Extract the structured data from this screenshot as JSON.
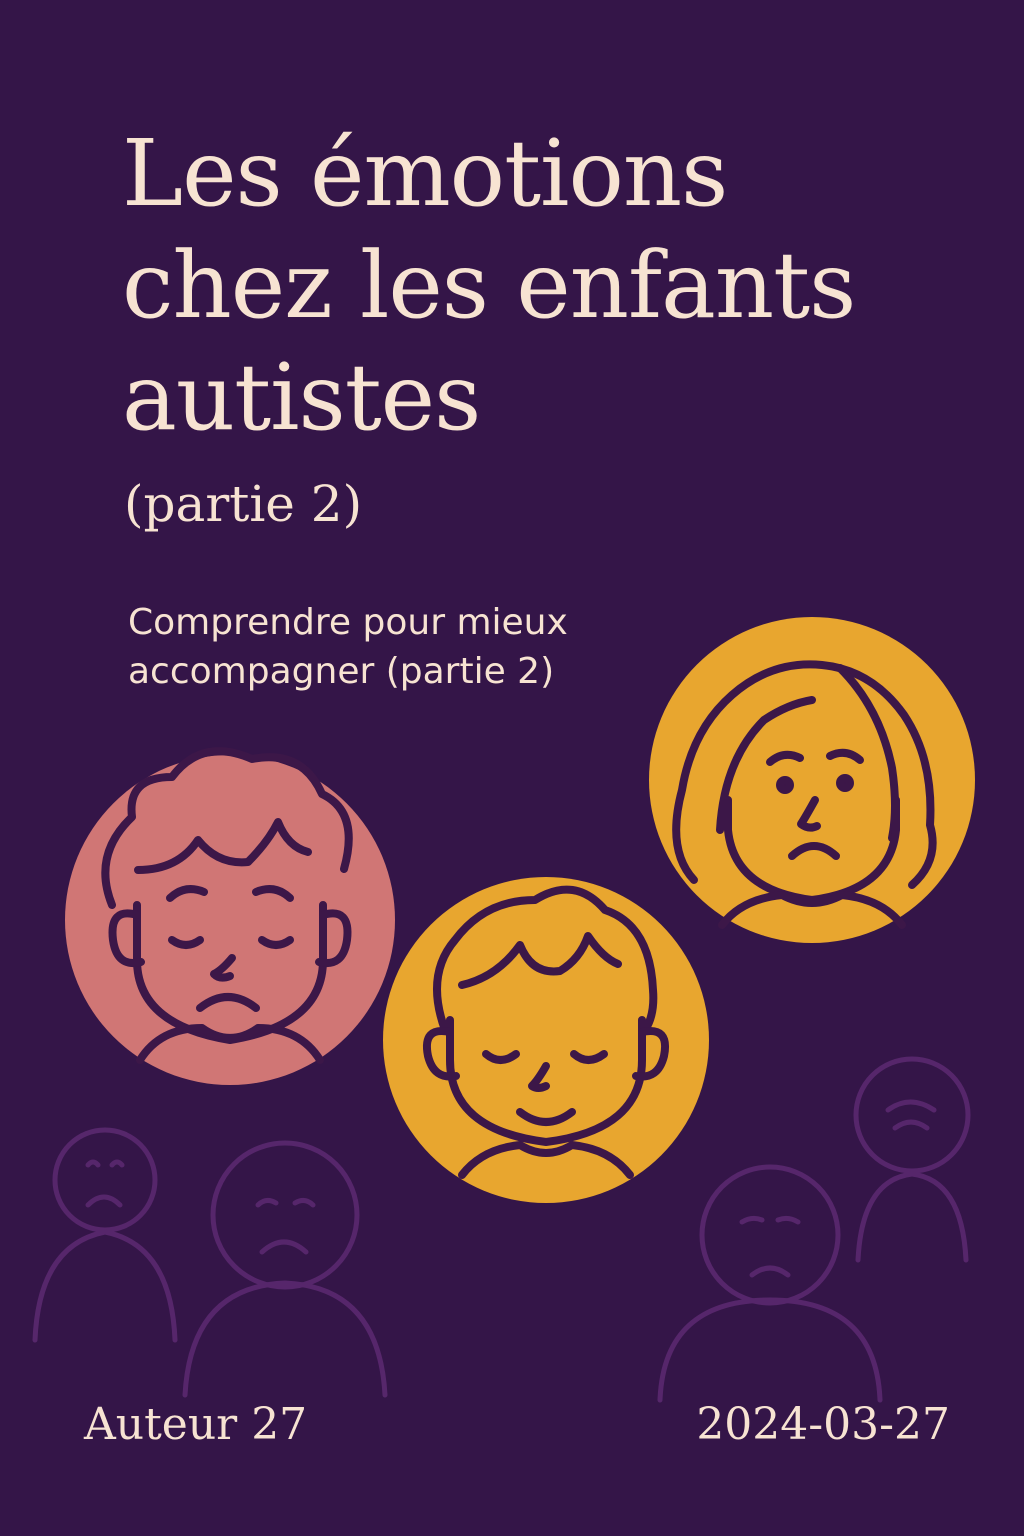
{
  "cover": {
    "title_lines": [
      "Les émotions",
      "chez les enfants",
      "autistes"
    ],
    "part": "(partie 2)",
    "subtitle_lines": [
      "Comprendre pour mieux",
      "accompagner (partie 2)"
    ],
    "author": "Auteur 27",
    "date": "2024-03-27"
  },
  "colors": {
    "background": "#341548",
    "text": "#f7e3d2",
    "pink_circle": "#d07675",
    "yellow_circle": "#e8a62f",
    "line_art": "#3c1748",
    "faded_figures": "#5d2a72"
  },
  "illustrations": [
    {
      "icon": "sad-child-closed-eyes-icon",
      "circle": "pink_circle"
    },
    {
      "icon": "calm-smiling-child-icon",
      "circle": "yellow_circle"
    },
    {
      "icon": "worried-girl-icon",
      "circle": "yellow_circle"
    },
    {
      "icon": "faded-sad-figures-icon",
      "circle": "faded_figures"
    }
  ]
}
